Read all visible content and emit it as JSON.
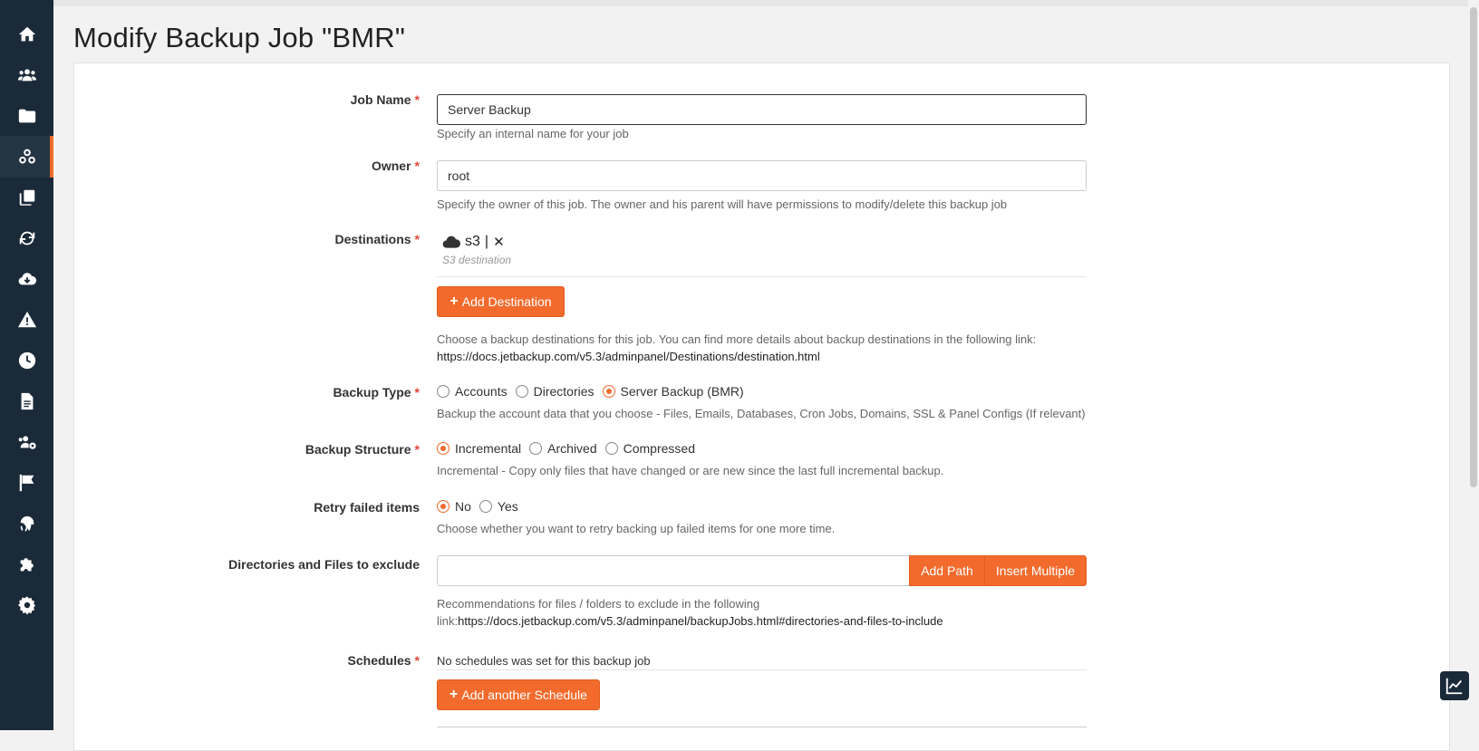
{
  "page": {
    "title": "Modify Backup Job \"BMR\""
  },
  "sidebar": {
    "items": [
      {
        "icon": "home-icon"
      },
      {
        "icon": "users-icon"
      },
      {
        "icon": "folder-icon"
      },
      {
        "icon": "biohazard-icon",
        "active": true
      },
      {
        "icon": "copy-icon"
      },
      {
        "icon": "sync-icon"
      },
      {
        "icon": "cloud-download-icon"
      },
      {
        "icon": "warning-icon"
      },
      {
        "icon": "clock-icon"
      },
      {
        "icon": "file-icon"
      },
      {
        "icon": "users-cog-icon"
      },
      {
        "icon": "flag-icon"
      },
      {
        "icon": "fingerprint-icon"
      },
      {
        "icon": "puzzle-icon"
      },
      {
        "icon": "gear-icon"
      }
    ]
  },
  "form": {
    "required_mark": "*",
    "job_name": {
      "label": "Job Name",
      "value": "Server Backup",
      "help": "Specify an internal name for your job"
    },
    "owner": {
      "label": "Owner",
      "value": "root",
      "help": "Specify the owner of this job. The owner and his parent will have permissions to modify/delete this backup job"
    },
    "destinations": {
      "label": "Destinations",
      "items": [
        {
          "name": "s3",
          "separator": "|",
          "remove": "✕",
          "subtitle": "S3 destination"
        }
      ],
      "add_button": "Add Destination",
      "help_line1": "Choose a backup destinations for this job. You can find more details about backup destinations in the following link:",
      "help_link": "https://docs.jetbackup.com/v5.3/adminpanel/Destinations/destination.html"
    },
    "backup_type": {
      "label": "Backup Type",
      "options": [
        "Accounts",
        "Directories",
        "Server Backup (BMR)"
      ],
      "selected": "Server Backup (BMR)",
      "help": "Backup the account data that you choose - Files, Emails, Databases, Cron Jobs, Domains, SSL & Panel Configs (If relevant)"
    },
    "backup_structure": {
      "label": "Backup Structure",
      "options": [
        "Incremental",
        "Archived",
        "Compressed"
      ],
      "selected": "Incremental",
      "help": "Incremental - Copy only files that have changed or are new since the last full incremental backup."
    },
    "retry_failed": {
      "label": "Retry failed items",
      "options": [
        "No",
        "Yes"
      ],
      "selected": "No",
      "help": "Choose whether you want to retry backing up failed items for one more time."
    },
    "exclude": {
      "label": "Directories and Files to exclude",
      "value": "",
      "add_path": "Add Path",
      "insert_multiple": "Insert Multiple",
      "help_line1": "Recommendations for files / folders to exclude in the following",
      "help_prefix": "link:",
      "help_link": "https://docs.jetbackup.com/v5.3/adminpanel/backupJobs.html#directories-and-files-to-include"
    },
    "schedules": {
      "label": "Schedules",
      "empty_text": "No schedules was set for this backup job",
      "add_button": "Add another Schedule"
    }
  },
  "colors": {
    "accent": "#f26b2d",
    "sidebar": "#1b2a38",
    "required": "#e0453a"
  }
}
